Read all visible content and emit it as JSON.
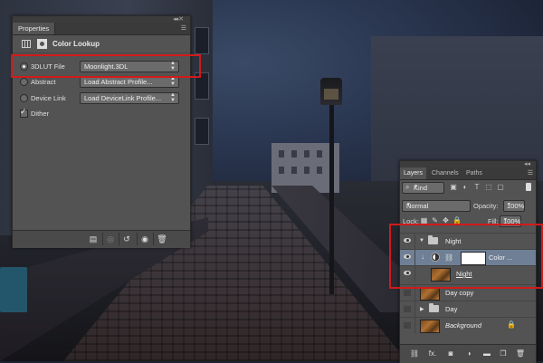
{
  "properties": {
    "tab": "Properties",
    "title": "Color Lookup",
    "rows": [
      {
        "label": "3DLUT File",
        "value": "Moonlight.3DL",
        "selected": true
      },
      {
        "label": "Abstract",
        "value": "Load Abstract Profile...",
        "selected": false
      },
      {
        "label": "Device Link",
        "value": "Load DeviceLink Profile...",
        "selected": false
      }
    ],
    "dither_label": "Dither",
    "dither_checked": true,
    "footer_icons": [
      "clip-to-layer-icon",
      "view-previous-icon",
      "reset-icon",
      "visibility-icon",
      "delete-icon"
    ]
  },
  "layers": {
    "tabs": [
      "Layers",
      "Channels",
      "Paths"
    ],
    "active_tab": "Layers",
    "filter_kind": "Kind",
    "blend_mode": "Normal",
    "opacity_label": "Opacity:",
    "opacity_value": "100%",
    "lock_label": "Lock:",
    "fill_label": "Fill:",
    "fill_value": "100%",
    "items": [
      {
        "name": "Night",
        "type": "group",
        "expanded": true,
        "visible": true
      },
      {
        "name": "Color ...",
        "type": "adjustment",
        "visible": true,
        "selected": true
      },
      {
        "name": "Night",
        "type": "pixel",
        "visible": true
      },
      {
        "name": "Day copy",
        "type": "pixel",
        "visible": false
      },
      {
        "name": "Day",
        "type": "group",
        "expanded": false,
        "visible": false
      },
      {
        "name": "Background",
        "type": "background",
        "visible": false,
        "locked": true
      }
    ],
    "footer_icons": [
      "link-icon",
      "fx-icon",
      "mask-icon",
      "adjustment-icon",
      "group-icon",
      "new-layer-icon",
      "trash-icon"
    ]
  },
  "colors": {
    "panel_bg": "#535353",
    "selected_row": "#6f7f96",
    "highlight": "#d11a1a"
  }
}
